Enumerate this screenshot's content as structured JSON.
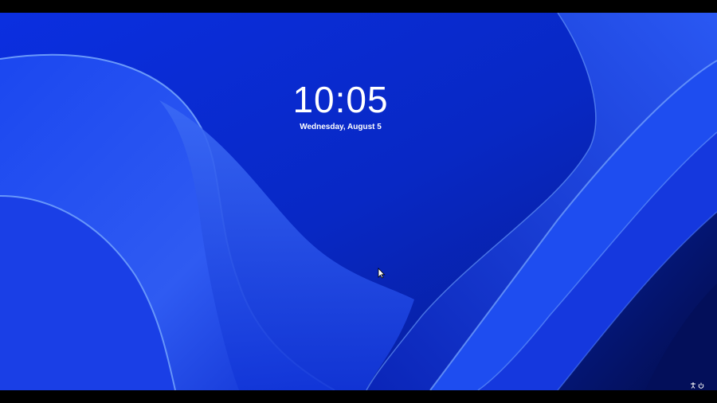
{
  "lockscreen": {
    "time": "10:05",
    "date": "Wednesday, August 5"
  },
  "tray": {
    "icons": [
      "accessibility-icon",
      "power-icon"
    ]
  },
  "colors": {
    "background": "#0a2fd6",
    "text": "#ffffff"
  }
}
